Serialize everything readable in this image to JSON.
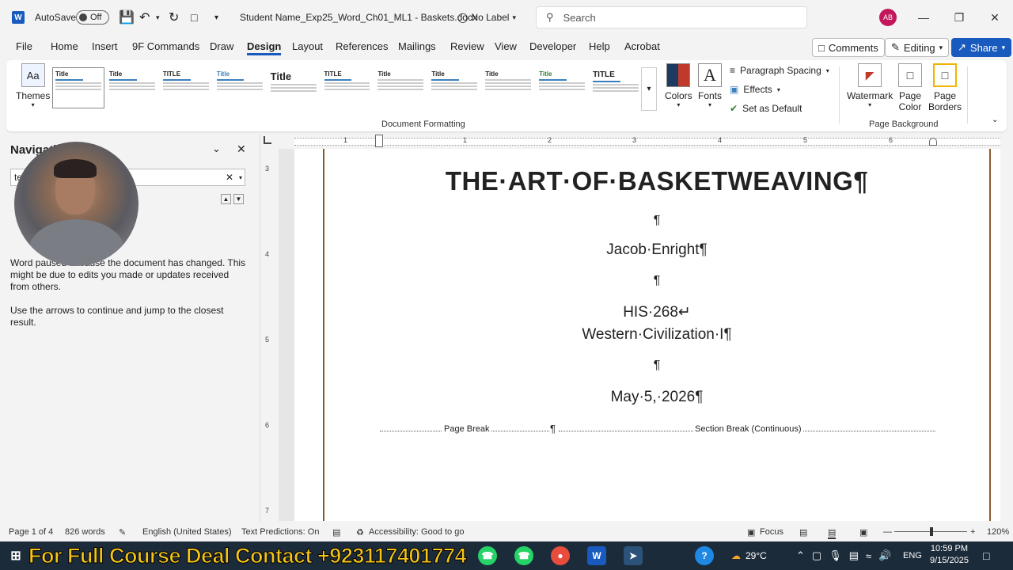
{
  "titlebar": {
    "app_logo": "W",
    "autosave_label": "AutoSave",
    "autosave_state": "Off",
    "doc_title": "Student Name_Exp25_Word_Ch01_ML1 - Baskets.docx",
    "label_text": "No Label",
    "search_placeholder": "Search",
    "user_initials": "AB"
  },
  "menu": {
    "items": [
      "File",
      "Home",
      "Insert",
      "9F Commands",
      "Draw",
      "Design",
      "Layout",
      "References",
      "Mailings",
      "Review",
      "View",
      "Developer",
      "Help",
      "Acrobat"
    ],
    "active": "Design",
    "comments_label": "Comments",
    "editing_label": "Editing",
    "share_label": "Share"
  },
  "ribbon": {
    "themes_label": "Themes",
    "gallery_titles": [
      "Title",
      "Title",
      "TITLE",
      "Title",
      "Title",
      "TITLE",
      "Title",
      "Title",
      "Title",
      "Title",
      "TITLE"
    ],
    "colors_label": "Colors",
    "fonts_label": "Fonts",
    "paragraph_spacing_label": "Paragraph Spacing",
    "effects_label": "Effects",
    "set_default_label": "Set as Default",
    "group_document_formatting": "Document Formatting",
    "watermark_label": "Watermark",
    "page_color_label": "Page Color",
    "page_borders_label": "Page Borders",
    "group_page_background": "Page Background"
  },
  "navpane": {
    "title": "Navigation",
    "search_value": "te",
    "message1": "Word paused because the document has changed. This might be due to edits you made or updates received from others.",
    "message2": "Use the arrows to continue and jump to the closest result."
  },
  "ruler": {
    "h_numbers": [
      "1",
      "1",
      "2",
      "3",
      "4",
      "5",
      "6"
    ],
    "v_numbers": [
      "3",
      "4",
      "5",
      "6",
      "7"
    ]
  },
  "document": {
    "title": "THE·ART·OF·BASKETWEAVING¶",
    "para_mark": "¶",
    "author": "Jacob·Enright¶",
    "course_code": "HIS·268↵",
    "course_name": "Western·Civilization·I¶",
    "date": "May·5,·2026¶",
    "page_break_label": "Page Break",
    "section_break_label": "Section Break (Continuous)"
  },
  "statusbar": {
    "page": "Page 1 of 4",
    "words": "826 words",
    "language": "English (United States)",
    "text_predictions": "Text Predictions: On",
    "accessibility": "Accessibility: Good to go",
    "focus": "Focus",
    "zoom": "120%"
  },
  "taskbar": {
    "promo": "For Full Course Deal Contact +923117401774",
    "temperature": "29°C",
    "language": "ENG",
    "time": "10:59 PM",
    "date": "9/15/2025"
  }
}
